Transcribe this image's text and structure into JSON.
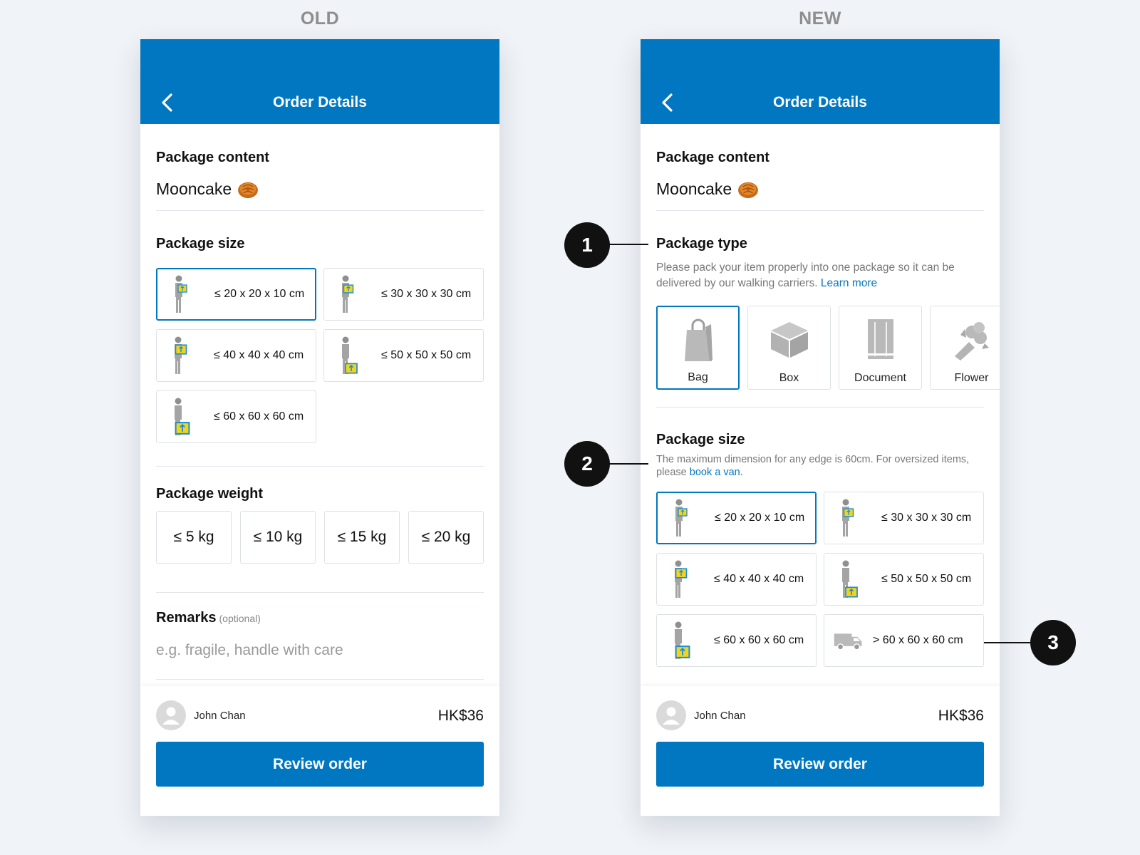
{
  "labels": {
    "old": "OLD",
    "new": "NEW"
  },
  "colors": {
    "brand": "#0177c1",
    "background": "#f0f3f7",
    "text": "#111111",
    "muted": "#777777"
  },
  "old": {
    "title": "Order Details",
    "content": {
      "heading": "Package content",
      "value": "Mooncake"
    },
    "size": {
      "heading": "Package size",
      "options": [
        "≤ 20 x 20 x 10 cm",
        "≤ 30 x 30 x 30 cm",
        "≤ 40 x 40 x 40 cm",
        "≤ 50 x 50 x 50 cm",
        "≤ 60 x 60 x 60 cm"
      ],
      "selected_index": 0
    },
    "weight": {
      "heading": "Package weight",
      "options": [
        "≤ 5 kg",
        "≤ 10 kg",
        "≤ 15 kg",
        "≤ 20 kg"
      ]
    },
    "remarks": {
      "heading": "Remarks",
      "optional": "(optional)",
      "placeholder": "e.g. fragile, handle with care"
    },
    "footer": {
      "user": "John Chan",
      "price": "HK$36",
      "button": "Review order"
    }
  },
  "new": {
    "title": "Order Details",
    "content": {
      "heading": "Package content",
      "value": "Mooncake"
    },
    "type": {
      "heading": "Package type",
      "desc": "Please pack your item properly into one package so it can be delivered by our walking carriers.",
      "link": "Learn more",
      "options": [
        {
          "label": "Bag",
          "icon": "bag-icon"
        },
        {
          "label": "Box",
          "icon": "box-icon"
        },
        {
          "label": "Document",
          "icon": "document-icon"
        },
        {
          "label": "Flower",
          "icon": "flower-icon"
        }
      ],
      "selected_index": 0
    },
    "size": {
      "heading": "Package size",
      "desc": "The maximum dimension for any edge is 60cm. For oversized items, please",
      "link": "book a van.",
      "options": [
        "≤ 20 x 20 x 10 cm",
        "≤ 30 x 30 x 30 cm",
        "≤ 40 x 40 x 40 cm",
        "≤ 50 x 50 x 50 cm",
        "≤ 60 x 60 x 60 cm",
        "> 60 x 60 x 60 cm"
      ],
      "selected_index": 0
    },
    "footer": {
      "user": "John Chan",
      "price": "HK$36",
      "button": "Review order"
    }
  },
  "callouts": [
    "1",
    "2",
    "3"
  ]
}
